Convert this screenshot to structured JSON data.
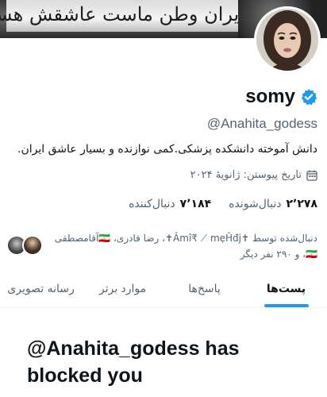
{
  "banner": {
    "text": "ایران وطن ماست عاشقش هستیم"
  },
  "profile": {
    "name": "somy",
    "handle": "@Anahita_godess",
    "bio": "دانش آموخته دانشکده پزشکی.کمی نوازنده و بسیار عاشق ایران.",
    "joined": "تاریخ پیوستن: ژانویهٔ ۲۰۲۴",
    "following_count": "۲٬۲۷۸",
    "following_label": "دنبال‌شونده",
    "followers_count": "۷٬۱۸۴",
    "followers_label": "دنبال‌کننده",
    "followed_by": "دنبال‌شده توسط ✝Âmî₹ ⟋ mẹȞđj✝، رضا قادری، 🇮🇷آقامصطفی 🇮🇷، و ۲۹۰ نفر دیگر",
    "verified_color": "#1d9bf0"
  },
  "tabs": [
    {
      "label": "پست‌ها",
      "active": true
    },
    {
      "label": "پاسخ‌ها",
      "active": false
    },
    {
      "label": "موارد برتر",
      "active": false
    },
    {
      "label": "رسانه تصویری",
      "active": false
    }
  ],
  "blocked_message": "@Anahita_godess has blocked you",
  "colors": {
    "accent": "#1d9bf0",
    "text": "#0f1419",
    "muted": "#536471"
  }
}
